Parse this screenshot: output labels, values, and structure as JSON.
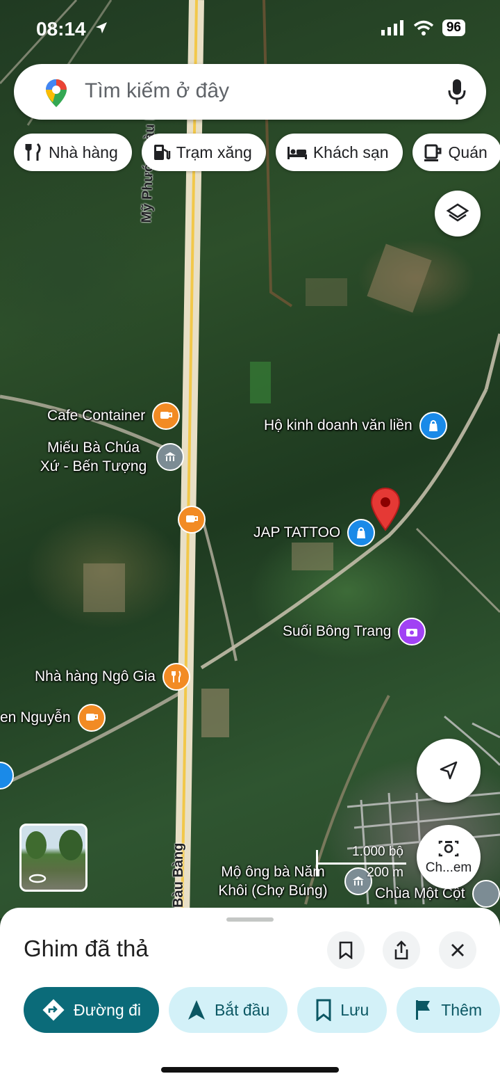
{
  "status": {
    "time": "08:14",
    "battery": "96"
  },
  "search": {
    "placeholder": "Tìm kiếm ở đây"
  },
  "chips": [
    {
      "label": "Nhà hàng",
      "icon": "fork-knife-icon"
    },
    {
      "label": "Trạm xăng",
      "icon": "gas-station-icon"
    },
    {
      "label": "Khách sạn",
      "icon": "bed-icon"
    },
    {
      "label": "Quán",
      "icon": "coffee-cup-icon"
    }
  ],
  "map": {
    "roads": {
      "main_north": "Mỹ Phước Bàu Bà",
      "main_south": "Bàu Bàng"
    },
    "pois": [
      {
        "name": "Cafe Container",
        "type": "cafe"
      },
      {
        "name": "Miếu Bà Chúa Xứ - Bến Tượng",
        "type": "religious"
      },
      {
        "name": "Hộ kinh doanh văn liền",
        "type": "shopping"
      },
      {
        "name": "JAP TATTOO",
        "type": "shopping"
      },
      {
        "name": "Suối Bông Trang",
        "type": "attraction"
      },
      {
        "name": "Nhà hàng Ngô Gia",
        "type": "restaurant"
      },
      {
        "name": "en Nguyễn",
        "type": "cafe"
      },
      {
        "name": "Mộ ông bà Năm Khôi (Chợ Búng)",
        "type": "religious"
      },
      {
        "name": "Chùa Một Cột",
        "type": "religious"
      }
    ],
    "scale": {
      "imperial": "1.000 bộ",
      "metric": "200 m"
    },
    "camera_label": "Ch...em"
  },
  "sheet": {
    "title": "Ghim đã thả",
    "actions": [
      {
        "label": "Đường đi",
        "icon": "directions-icon"
      },
      {
        "label": "Bắt đầu",
        "icon": "navigation-arrow-icon"
      },
      {
        "label": "Lưu",
        "icon": "bookmark-icon"
      },
      {
        "label": "Thêm",
        "icon": "flag-icon"
      }
    ]
  },
  "colors": {
    "primary_action": "#0b6b79",
    "action_bg": "#d3f1f8",
    "pin": "#e53935",
    "cafe": "#f28b24",
    "shop": "#1a8ae8",
    "attraction": "#a142f4",
    "religious": "#7c8c94"
  }
}
